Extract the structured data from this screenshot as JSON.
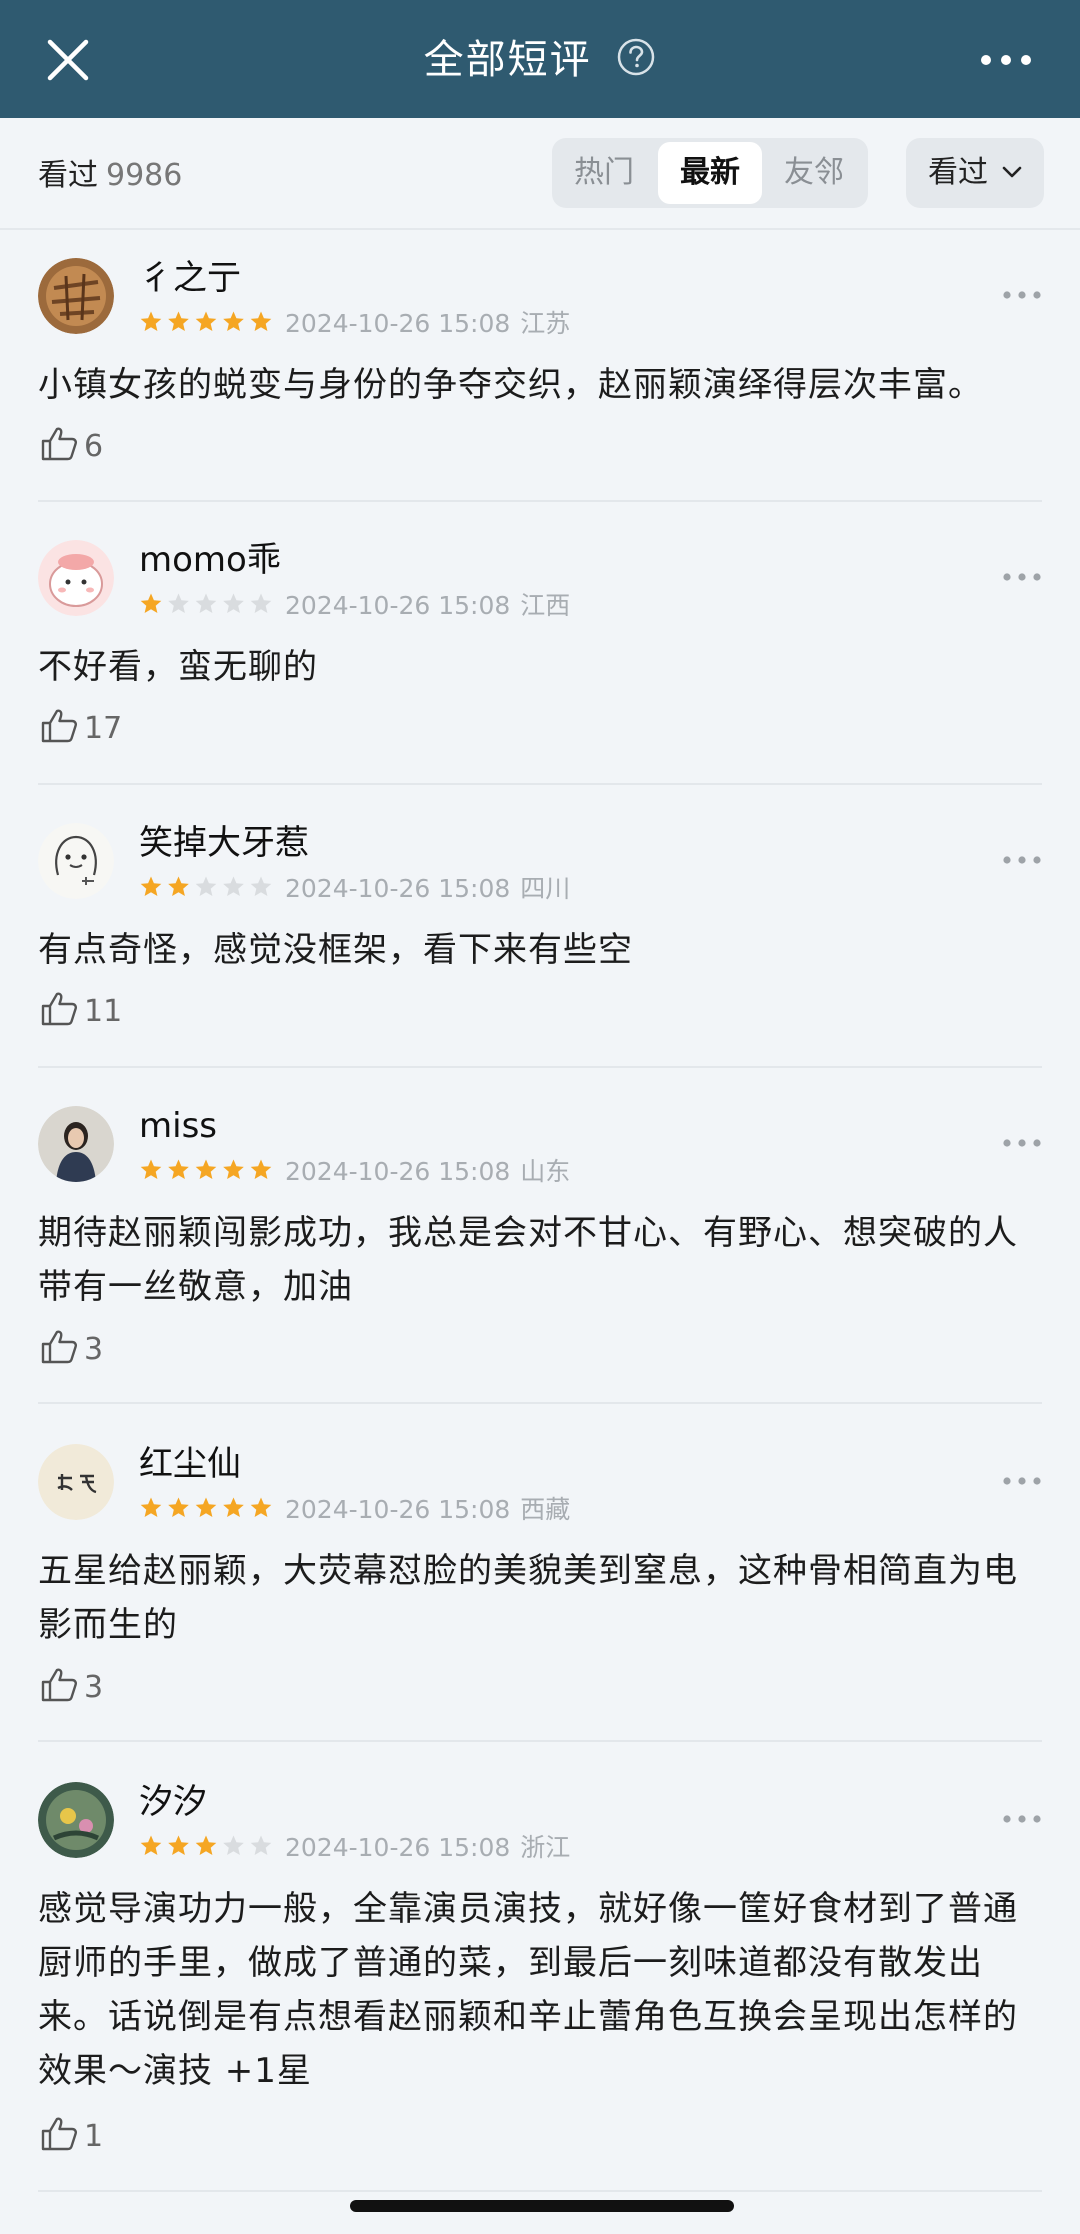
{
  "header": {
    "title": "全部短评",
    "help_icon": "question-circle-icon",
    "close_icon": "close-icon",
    "more_icon": "more-icon"
  },
  "filter": {
    "watched_label": "看过",
    "watched_count": "9986",
    "tabs": [
      "热门",
      "最新",
      "友邻"
    ],
    "active_tab": "最新",
    "dropdown_label": "看过"
  },
  "colors": {
    "header_bg": "#2f5a70",
    "star_on": "#f5a623",
    "star_off": "#d9dcdf"
  },
  "comments": [
    {
      "name": "彳之亍",
      "rating": 5,
      "time": "2024-10-26 15:08",
      "location": "江苏",
      "text": "小镇女孩的蜕变与身份的争夺交织，赵丽颖演绎得层次丰富。",
      "likes": "6"
    },
    {
      "name": "momo乖",
      "rating": 1,
      "time": "2024-10-26 15:08",
      "location": "江西",
      "text": "不好看，蛮无聊的",
      "likes": "17"
    },
    {
      "name": "笑掉大牙惹",
      "rating": 2,
      "time": "2024-10-26 15:08",
      "location": "四川",
      "text": "有点奇怪，感觉没框架，看下来有些空",
      "likes": "11"
    },
    {
      "name": "miss",
      "rating": 5,
      "time": "2024-10-26 15:08",
      "location": "山东",
      "text": "期待赵丽颖闯影成功，我总是会对不甘心、有野心、想突破的人带有一丝敬意，加油",
      "likes": "3"
    },
    {
      "name": "红尘仙",
      "rating": 5,
      "time": "2024-10-26 15:08",
      "location": "西藏",
      "text": "五星给赵丽颖，大荧幕怼脸的美貌美到窒息，这种骨相简直为电影而生的",
      "likes": "3"
    },
    {
      "name": "汐汐",
      "rating": 3,
      "time": "2024-10-26 15:08",
      "location": "浙江",
      "text": "感觉导演功力一般，全靠演员演技，就好像一筐好食材到了普通厨师的手里，做成了普通的菜，到最后一刻味道都没有散发出来。话说倒是有点想看赵丽颖和辛止蕾角色互换会呈现出怎样的效果～演技 +1星",
      "likes": "1"
    }
  ]
}
